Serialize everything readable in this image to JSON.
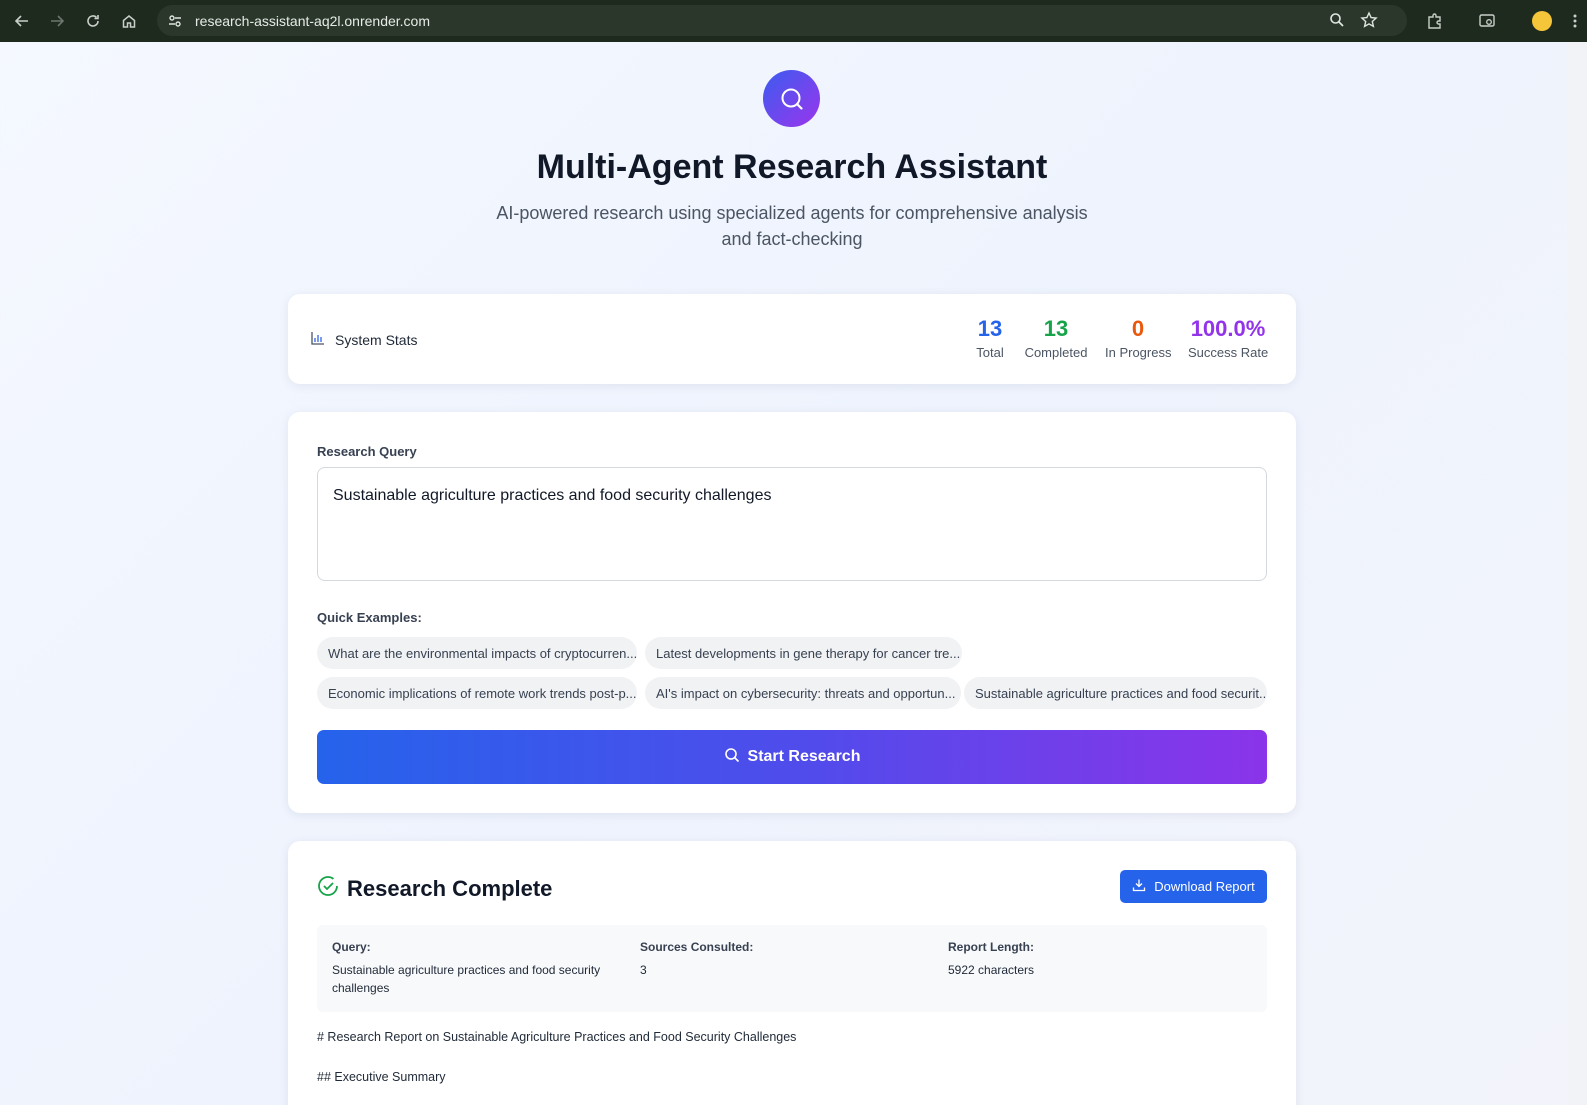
{
  "browser": {
    "url": "research-assistant-aq2l.onrender.com"
  },
  "header": {
    "icon": "search-icon",
    "title": "Multi-Agent Research Assistant",
    "subtitle": "AI-powered research using specialized agents for comprehensive analysis and fact-checking"
  },
  "stats": {
    "label": "System Stats",
    "items": [
      {
        "value": "13",
        "label": "Total",
        "color": "#2563eb"
      },
      {
        "value": "13",
        "label": "Completed",
        "color": "#16a34a"
      },
      {
        "value": "0",
        "label": "In Progress",
        "color": "#ea580c"
      },
      {
        "value": "100.0%",
        "label": "Success Rate",
        "color": "#9333ea"
      }
    ]
  },
  "query": {
    "label": "Research Query",
    "value": "Sustainable agriculture practices and food security challenges",
    "examples_label": "Quick Examples:",
    "examples": [
      "What are the environmental impacts of cryptocurren...",
      "Latest developments in gene therapy for cancer tre...",
      "Economic implications of remote work trends post-p...",
      "AI's impact on cybersecurity: threats and opportun...",
      "Sustainable agriculture practices and food securit..."
    ],
    "start_label": "Start Research"
  },
  "result": {
    "title": "Research Complete",
    "download_label": "Download Report",
    "meta": {
      "query_key": "Query:",
      "query_val": "Sustainable agriculture practices and food security challenges",
      "sources_key": "Sources Consulted:",
      "sources_val": "3",
      "length_key": "Report Length:",
      "length_val": "5922 characters"
    },
    "report_lines": [
      "# Research Report on Sustainable Agriculture Practices and Food Security Challenges",
      "## Executive Summary"
    ]
  }
}
